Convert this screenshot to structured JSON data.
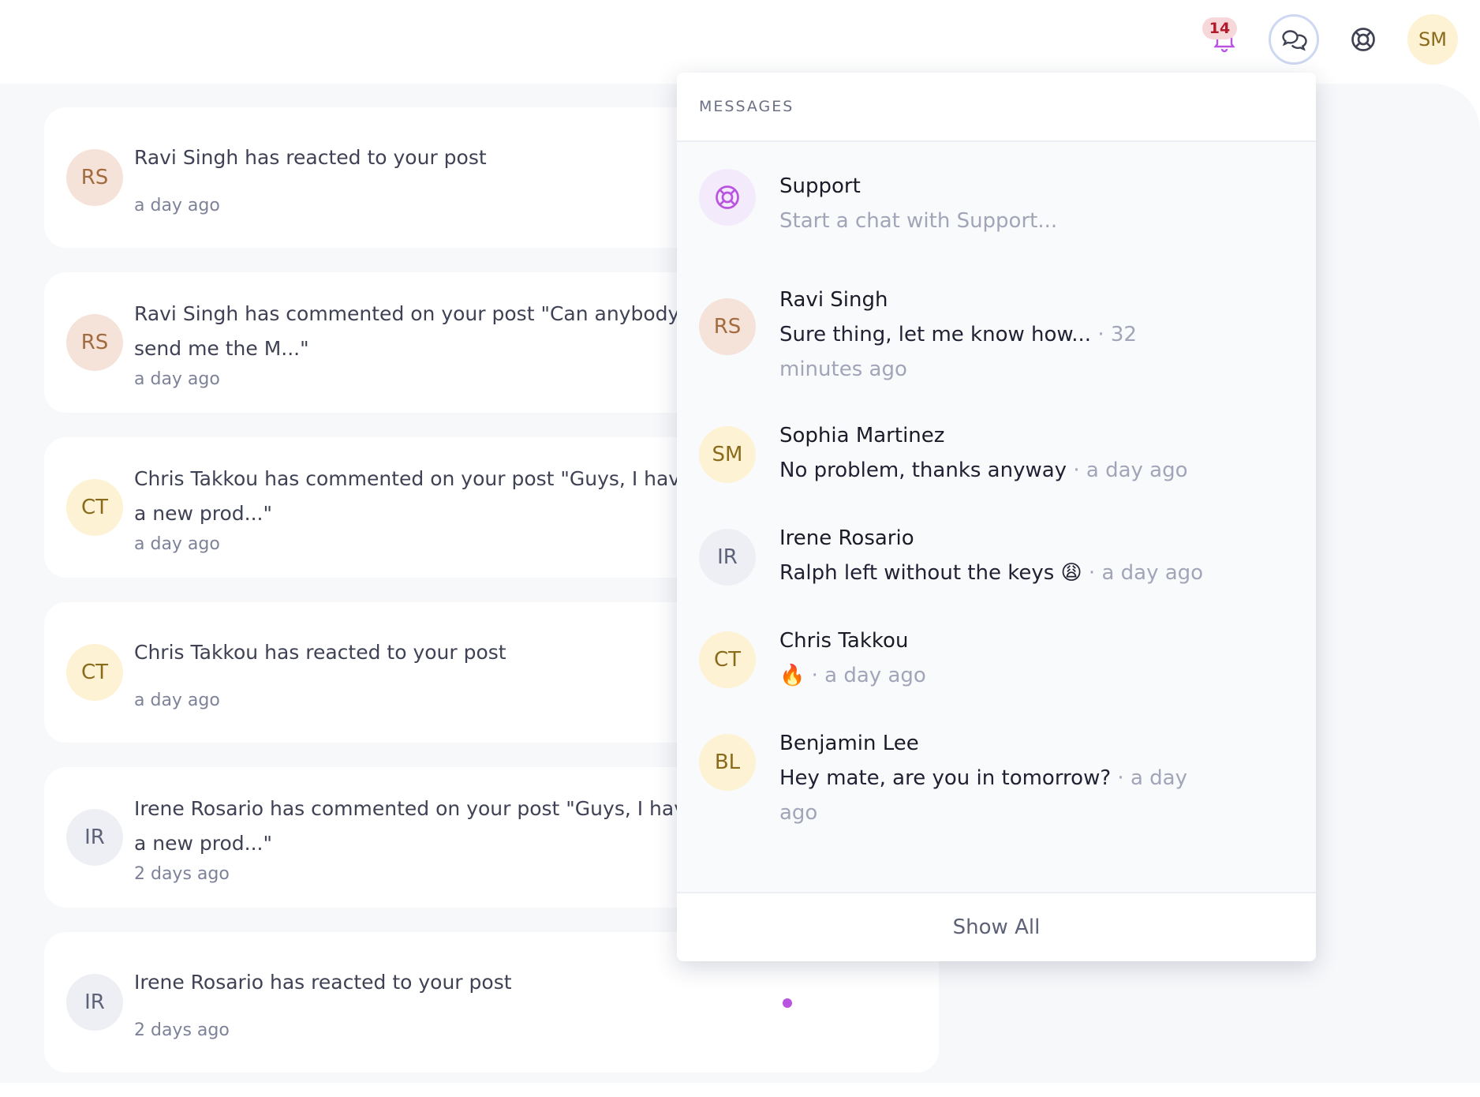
{
  "header": {
    "notifications_count": "14",
    "user_initials": "SM",
    "icons": [
      "bell-icon",
      "chat-icon",
      "lifebuoy-icon"
    ]
  },
  "notifications": [
    {
      "initials": "RS",
      "message": "Ravi Singh has reacted to your post",
      "time": "a day ago"
    },
    {
      "initials": "RS",
      "message": "Ravi Singh has commented on your post \"Can anybody send me the M...\"",
      "time": "a day ago"
    },
    {
      "initials": "CT",
      "message": "Chris Takkou has commented on your post \"Guys, I have a new prod...\"",
      "time": "a day ago"
    },
    {
      "initials": "CT",
      "message": "Chris Takkou has reacted to your post",
      "time": "a day ago"
    },
    {
      "initials": "IR",
      "message": "Irene Rosario has commented on your post \"Guys, I have a new prod...\"",
      "time": "2 days ago"
    },
    {
      "initials": "IR",
      "message": "Irene Rosario has reacted to your post",
      "time": "2 days ago"
    }
  ],
  "messages_panel": {
    "title": "MESSAGES",
    "support": {
      "name": "Support",
      "placeholder": "Start a chat with Support..."
    },
    "items": [
      {
        "initials": "RS",
        "name": "Ravi Singh",
        "text": "Sure thing, let me know how...",
        "time": "32 minutes ago"
      },
      {
        "initials": "SM",
        "name": "Sophia Martinez",
        "text": "No problem, thanks anyway",
        "time": "a day ago"
      },
      {
        "initials": "IR",
        "name": "Irene Rosario",
        "text": "Ralph left without the keys 😩",
        "time": "a day ago"
      },
      {
        "initials": "CT",
        "name": "Chris Takkou",
        "text": "🔥",
        "time": "a day ago"
      },
      {
        "initials": "BL",
        "name": "Benjamin Lee",
        "text": "Hey mate, are you in tomorrow?",
        "time": "a day ago"
      }
    ],
    "separator": "·",
    "show_all_label": "Show All"
  },
  "colors": {
    "accent": "#b954e0",
    "badge_bg": "#f6d8da",
    "badge_text": "#b11a2a",
    "muted": "#a1a5b7"
  }
}
